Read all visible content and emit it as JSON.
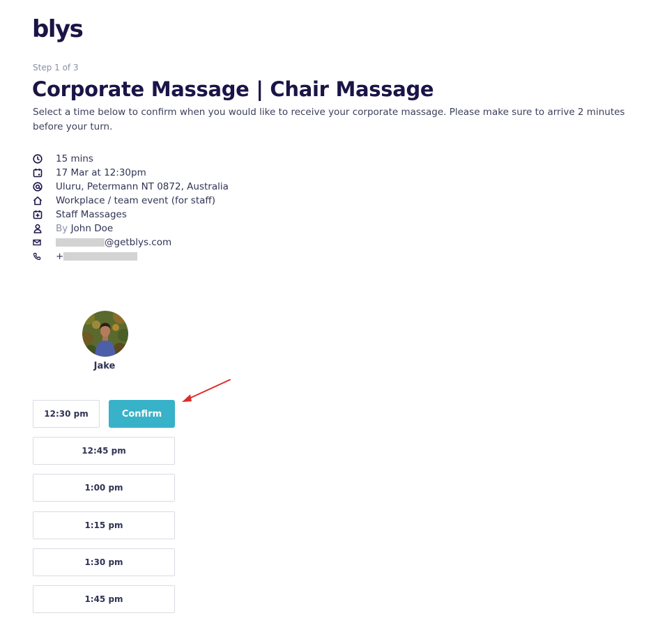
{
  "brand": {
    "logo_text": "blys"
  },
  "header": {
    "step": "Step 1 of 3",
    "title": "Corporate Massage | Chair Massage",
    "description": "Select a time below to confirm when you would like to receive your corporate massage. Please make sure to arrive 2 minutes before your turn."
  },
  "details": {
    "duration": "15 mins",
    "datetime": "17 Mar at 12:30pm",
    "location": "Uluru, Petermann NT 0872, Australia",
    "venue_type": "Workplace / team event (for staff)",
    "event_name": "Staff Massages",
    "by_prefix": "By",
    "by_name": "John Doe",
    "email_domain": "@getblys.com",
    "phone_prefix": "+"
  },
  "therapist": {
    "name": "Jake"
  },
  "slots": {
    "selected": "12:30 pm",
    "confirm_label": "Confirm",
    "times": [
      "12:45 pm",
      "1:00 pm",
      "1:15 pm",
      "1:30 pm",
      "1:45 pm"
    ]
  },
  "colors": {
    "brand_navy": "#1a1447",
    "accent_teal": "#37b2c8",
    "annotation_red": "#e02a2a"
  },
  "icons": [
    "clock-icon",
    "calendar-icon",
    "location-pin-icon",
    "home-icon",
    "calendar-plus-icon",
    "user-icon",
    "mail-icon",
    "phone-icon",
    "annotation-arrow"
  ]
}
